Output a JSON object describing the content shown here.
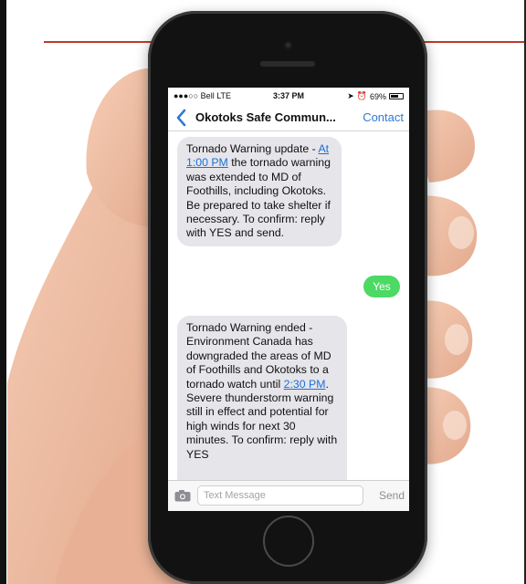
{
  "status": {
    "carrier": "●●●○○ Bell  LTE",
    "time": "3:37 PM",
    "battery": "69%",
    "battery_level": 0.69
  },
  "nav": {
    "title": "Okotoks Safe Commun...",
    "contact_label": "Contact"
  },
  "messages": [
    {
      "from": "contact",
      "before": "Tornado Warning update - ",
      "link": "At 1:00 PM",
      "after": " the tornado warning was extended to MD of Foothills, including Okotoks. Be prepared to take shelter if necessary. To confirm: reply with YES and send."
    },
    {
      "from": "me",
      "text": "Yes"
    },
    {
      "from": "contact",
      "before": "Tornado Warning ended - Environment Canada has downgraded the areas of MD of Foothills and Okotoks to a tornado watch until ",
      "link": "2:30 PM",
      "after": ". Severe thunderstorm warning still in effect and potential for high winds for next 30 minutes.    To confirm: reply with YES"
    }
  ],
  "composer": {
    "placeholder": "Text Message",
    "send_label": "Send"
  },
  "colors": {
    "accent": "#2e7bd6",
    "sent_bubble": "#4cd964",
    "received_bubble": "#e5e5ea",
    "rule": "#c0392b"
  }
}
